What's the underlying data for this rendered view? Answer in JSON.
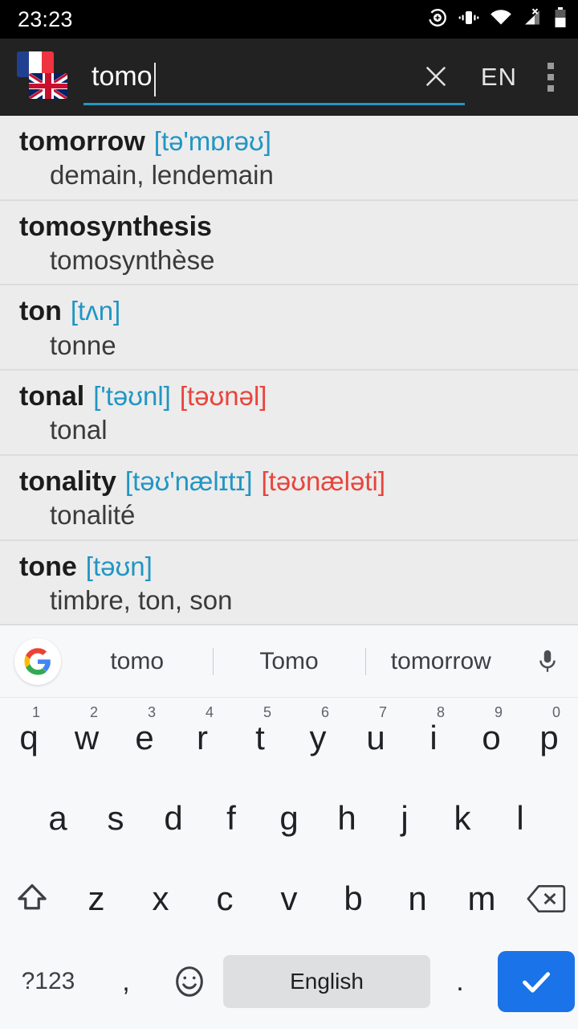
{
  "status_bar": {
    "clock": "23:23",
    "icons": [
      {
        "name": "location-icon"
      },
      {
        "name": "vibrate-icon"
      },
      {
        "name": "wifi-icon"
      },
      {
        "name": "cellular-no-sim-icon"
      },
      {
        "name": "battery-icon"
      }
    ]
  },
  "app_bar": {
    "flag_source": "flag-fr",
    "flag_target": "flag-uk",
    "search_value": "tomo",
    "search_placeholder": "",
    "clear_label": "×",
    "language_label": "EN",
    "menu_label": "more-options",
    "underline_color": "#2196c4"
  },
  "results": [
    {
      "term": "tomorrow",
      "ipa_uk": "[tə'mɒrəʊ]",
      "ipa_us": "",
      "translation": "demain, lendemain"
    },
    {
      "term": "tomosynthesis",
      "ipa_uk": "",
      "ipa_us": "",
      "translation": "tomosynthèse"
    },
    {
      "term": "ton",
      "ipa_uk": "[tʌn]",
      "ipa_us": "",
      "translation": "tonne"
    },
    {
      "term": "tonal",
      "ipa_uk": "['təʊnl]",
      "ipa_us": "[təʊnəl]",
      "translation": "tonal"
    },
    {
      "term": "tonality",
      "ipa_uk": "[təʊ'nælɪtɪ]",
      "ipa_us": "[təʊnæləti]",
      "translation": "tonalité"
    },
    {
      "term": "tone",
      "ipa_uk": "[təʊn]",
      "ipa_us": "",
      "translation": "timbre, ton, son"
    },
    {
      "term": "",
      "ipa_uk": "",
      "ipa_us": "",
      "translation": ""
    }
  ],
  "colors": {
    "ipa_uk": "#2196c4",
    "ipa_us": "#e8453c",
    "accent": "#2196c4",
    "enter_key": "#1a73e8",
    "list_background": "#ececec",
    "appbar_background": "#222222",
    "keyboard_background": "#f7f8fa"
  },
  "keyboard": {
    "suggestions": [
      "tomo",
      "Tomo",
      "tomorrow"
    ],
    "logo_name": "google-logo-icon",
    "mic_name": "microphone-icon",
    "row1": [
      {
        "key": "q",
        "num": "1"
      },
      {
        "key": "w",
        "num": "2"
      },
      {
        "key": "e",
        "num": "3"
      },
      {
        "key": "r",
        "num": "4"
      },
      {
        "key": "t",
        "num": "5"
      },
      {
        "key": "y",
        "num": "6"
      },
      {
        "key": "u",
        "num": "7"
      },
      {
        "key": "i",
        "num": "8"
      },
      {
        "key": "o",
        "num": "9"
      },
      {
        "key": "p",
        "num": "0"
      }
    ],
    "row2": [
      "a",
      "s",
      "d",
      "f",
      "g",
      "h",
      "j",
      "k",
      "l"
    ],
    "row3": [
      "z",
      "x",
      "c",
      "v",
      "b",
      "n",
      "m"
    ],
    "shift_label": "shift-key",
    "backspace_label": "backspace-key",
    "symbols_label": "?123",
    "comma_label": ",",
    "emoji_label": "emoji-key",
    "space_label": "English",
    "period_label": ".",
    "enter_label": "enter-key"
  }
}
